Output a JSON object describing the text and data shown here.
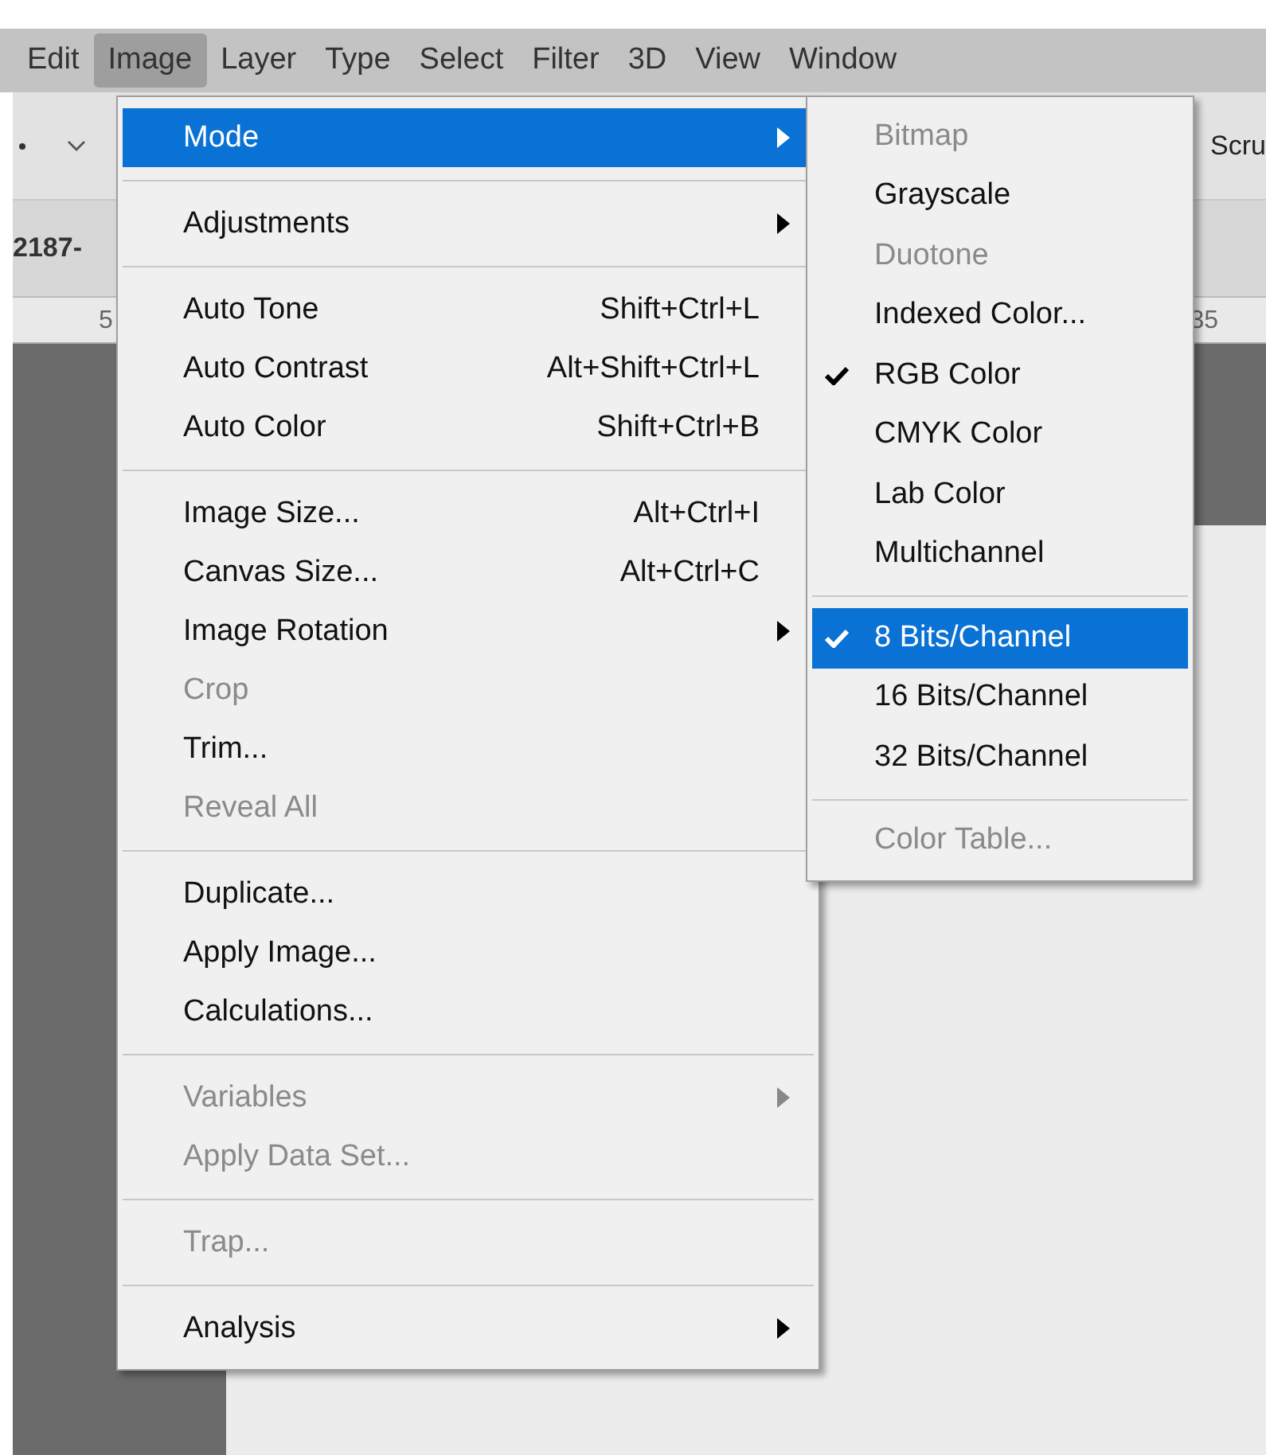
{
  "menubar": [
    {
      "label": "Edit",
      "selected": false
    },
    {
      "label": "Image",
      "selected": true
    },
    {
      "label": "Layer",
      "selected": false
    },
    {
      "label": "Type",
      "selected": false
    },
    {
      "label": "Select",
      "selected": false
    },
    {
      "label": "Filter",
      "selected": false
    },
    {
      "label": "3D",
      "selected": false
    },
    {
      "label": "View",
      "selected": false
    },
    {
      "label": "Window",
      "selected": false
    }
  ],
  "options_bar": {
    "label": "Scru"
  },
  "document_tab": {
    "title": "2187-"
  },
  "ruler": {
    "labels": [
      "5",
      "35"
    ]
  },
  "image_menu": [
    {
      "kind": "item",
      "label": "Mode",
      "disabled": false,
      "submenu": true,
      "selected": true
    },
    {
      "kind": "separator"
    },
    {
      "kind": "item",
      "label": "Adjustments",
      "disabled": false,
      "submenu": true,
      "selected": false
    },
    {
      "kind": "separator"
    },
    {
      "kind": "item",
      "label": "Auto Tone",
      "shortcut": "Shift+Ctrl+L",
      "disabled": false,
      "submenu": false,
      "selected": false
    },
    {
      "kind": "item",
      "label": "Auto Contrast",
      "shortcut": "Alt+Shift+Ctrl+L",
      "disabled": false,
      "submenu": false,
      "selected": false
    },
    {
      "kind": "item",
      "label": "Auto Color",
      "shortcut": "Shift+Ctrl+B",
      "disabled": false,
      "submenu": false,
      "selected": false
    },
    {
      "kind": "separator"
    },
    {
      "kind": "item",
      "label": "Image Size...",
      "shortcut": "Alt+Ctrl+I",
      "disabled": false,
      "submenu": false,
      "selected": false
    },
    {
      "kind": "item",
      "label": "Canvas Size...",
      "shortcut": "Alt+Ctrl+C",
      "disabled": false,
      "submenu": false,
      "selected": false
    },
    {
      "kind": "item",
      "label": "Image Rotation",
      "disabled": false,
      "submenu": true,
      "selected": false
    },
    {
      "kind": "item",
      "label": "Crop",
      "disabled": true,
      "submenu": false,
      "selected": false
    },
    {
      "kind": "item",
      "label": "Trim...",
      "disabled": false,
      "submenu": false,
      "selected": false
    },
    {
      "kind": "item",
      "label": "Reveal All",
      "disabled": true,
      "submenu": false,
      "selected": false
    },
    {
      "kind": "separator"
    },
    {
      "kind": "item",
      "label": "Duplicate...",
      "disabled": false,
      "submenu": false,
      "selected": false
    },
    {
      "kind": "item",
      "label": "Apply Image...",
      "disabled": false,
      "submenu": false,
      "selected": false
    },
    {
      "kind": "item",
      "label": "Calculations...",
      "disabled": false,
      "submenu": false,
      "selected": false
    },
    {
      "kind": "separator"
    },
    {
      "kind": "item",
      "label": "Variables",
      "disabled": true,
      "submenu": true,
      "selected": false
    },
    {
      "kind": "item",
      "label": "Apply Data Set...",
      "disabled": true,
      "submenu": false,
      "selected": false
    },
    {
      "kind": "separator"
    },
    {
      "kind": "item",
      "label": "Trap...",
      "disabled": true,
      "submenu": false,
      "selected": false
    },
    {
      "kind": "separator"
    },
    {
      "kind": "item",
      "label": "Analysis",
      "disabled": false,
      "submenu": true,
      "selected": false
    }
  ],
  "mode_submenu": [
    {
      "kind": "item",
      "label": "Bitmap",
      "disabled": true,
      "checked": false,
      "selected": false
    },
    {
      "kind": "item",
      "label": "Grayscale",
      "disabled": false,
      "checked": false,
      "selected": false
    },
    {
      "kind": "item",
      "label": "Duotone",
      "disabled": true,
      "checked": false,
      "selected": false
    },
    {
      "kind": "item",
      "label": "Indexed Color...",
      "disabled": false,
      "checked": false,
      "selected": false
    },
    {
      "kind": "item",
      "label": "RGB Color",
      "disabled": false,
      "checked": true,
      "selected": false
    },
    {
      "kind": "item",
      "label": "CMYK Color",
      "disabled": false,
      "checked": false,
      "selected": false
    },
    {
      "kind": "item",
      "label": "Lab Color",
      "disabled": false,
      "checked": false,
      "selected": false
    },
    {
      "kind": "item",
      "label": "Multichannel",
      "disabled": false,
      "checked": false,
      "selected": false
    },
    {
      "kind": "separator"
    },
    {
      "kind": "item",
      "label": "8 Bits/Channel",
      "disabled": false,
      "checked": true,
      "selected": true
    },
    {
      "kind": "item",
      "label": "16 Bits/Channel",
      "disabled": false,
      "checked": false,
      "selected": false
    },
    {
      "kind": "item",
      "label": "32 Bits/Channel",
      "disabled": false,
      "checked": false,
      "selected": false
    },
    {
      "kind": "separator"
    },
    {
      "kind": "item",
      "label": "Color Table...",
      "disabled": true,
      "checked": false,
      "selected": false
    }
  ]
}
